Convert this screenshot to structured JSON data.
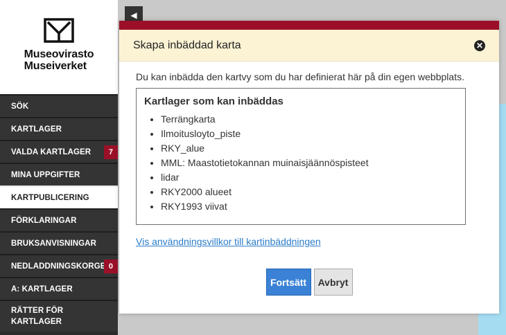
{
  "sidebar": {
    "logo_line1": "Museovirasto",
    "logo_line2": "Museiverket",
    "items": [
      {
        "label": "SÖK"
      },
      {
        "label": "KARTLAGER"
      },
      {
        "label": "VALDA KARTLAGER",
        "badge": "7"
      },
      {
        "label": "MINA UPPGIFTER"
      },
      {
        "label": "KARTPUBLICERING",
        "active": true
      },
      {
        "label": "FÖRKLARINGAR"
      },
      {
        "label": "BRUKSANVISNINGAR"
      },
      {
        "label": "NEDLADDNINGSKORGEN",
        "badge": "0"
      },
      {
        "label": "A: KARTLAGER"
      },
      {
        "label_line1": "RÄTTER FÖR",
        "label_line2": "KARTLAGER"
      }
    ]
  },
  "map": {
    "toggle_icon": "chevron-left-icon",
    "toggle_glyph": "◀"
  },
  "dialog": {
    "title": "Skapa inbäddad karta",
    "close_glyph": "✕",
    "intro": "Du kan inbädda den kartvy som du har definierat här på din egen webbplats.",
    "box_title": "Kartlager som kan inbäddas",
    "layers": [
      "Terrängkarta",
      "Ilmoitusloyto_piste",
      "RKY_alue",
      "MML: Maastotietokannan muinaisjäännöspisteet",
      "lidar",
      "RKY2000 alueet",
      "RKY1993 viivat"
    ],
    "terms_link": "Vis användningsvillkor till kartinbäddningen",
    "continue_label": "Fortsätt",
    "cancel_label": "Avbryt"
  },
  "colors": {
    "accent": "#9b1028",
    "header_bg": "#fbf3d4",
    "primary_button": "#3b82d6",
    "sidebar_bg": "#343434",
    "water": "#a6dcf2"
  }
}
